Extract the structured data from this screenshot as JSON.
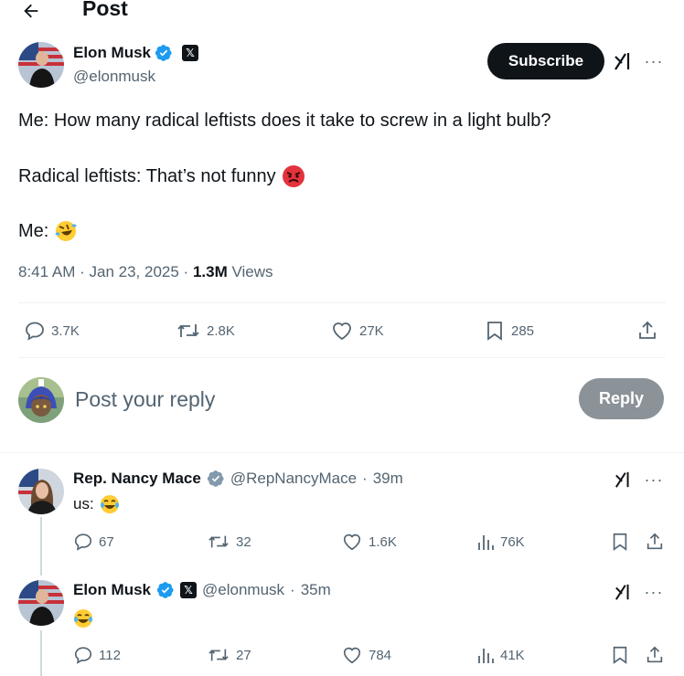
{
  "header": {
    "title": "Post"
  },
  "post": {
    "author_name": "Elon Musk",
    "author_handle": "@elonmusk",
    "subscribe_label": "Subscribe",
    "text_line1": "Me: How many radical leftists does it take to screw in a light bulb?",
    "text_line2": "Radical leftists: That’s not funny",
    "text_line3": "Me:",
    "time": "8:41 AM",
    "date": "Jan 23, 2025",
    "views_count": "1.3M",
    "views_label": "Views",
    "replies": "3.7K",
    "reposts": "2.8K",
    "likes": "27K",
    "bookmarks": "285"
  },
  "composer": {
    "placeholder": "Post your reply",
    "reply_button": "Reply"
  },
  "replies": [
    {
      "name": "Rep. Nancy Mace",
      "handle": "@RepNancyMace",
      "time": "39m",
      "text": "us:",
      "replies": "67",
      "reposts": "32",
      "likes": "1.6K",
      "views": "76K"
    },
    {
      "name": "Elon Musk",
      "handle": "@elonmusk",
      "time": "35m",
      "text": "",
      "replies": "112",
      "reposts": "27",
      "likes": "784",
      "views": "41K"
    }
  ],
  "colors": {
    "verified_blue": "#1d9bf0",
    "verified_gray": "#829aab",
    "muted": "#536471",
    "text": "#0f1419"
  }
}
